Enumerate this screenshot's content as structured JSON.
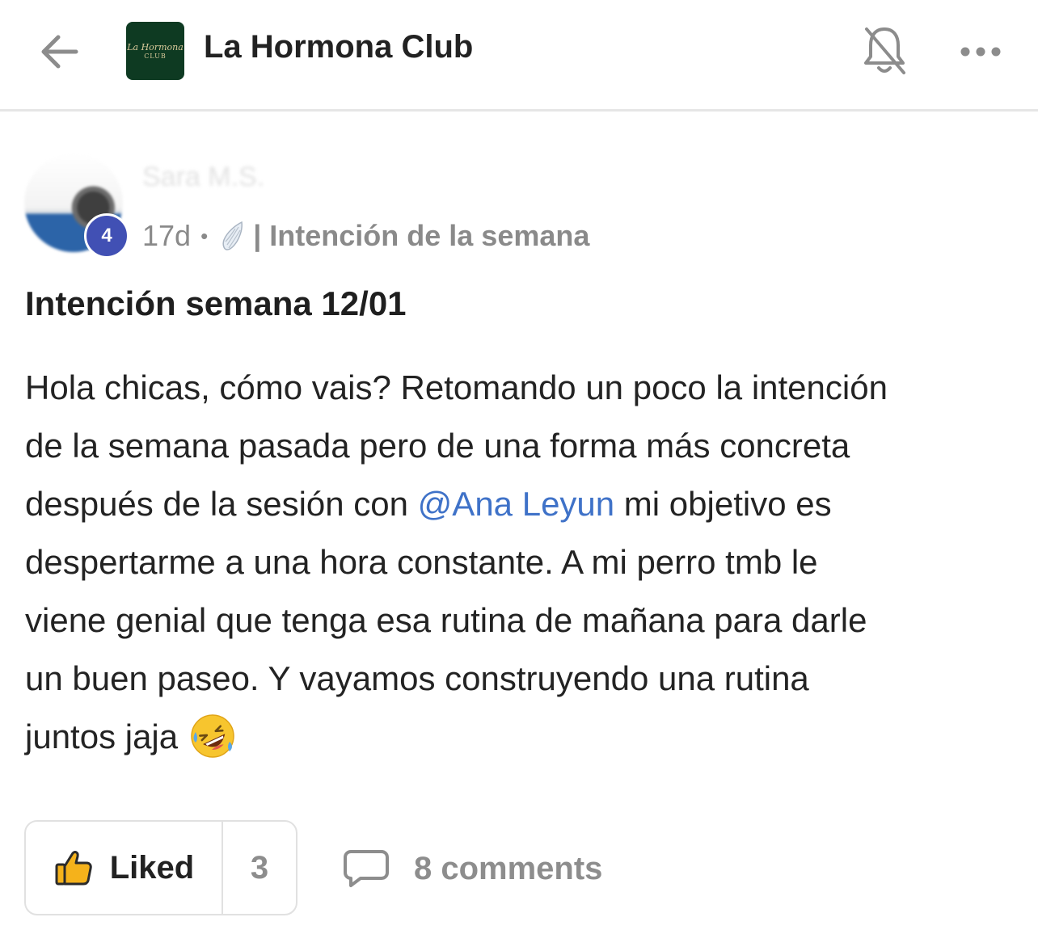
{
  "header": {
    "back_icon": "arrow-left-icon",
    "club_name": "La Hormona Club",
    "logo_line1": "La Hormona",
    "logo_line2": "CLUB",
    "notification_icon": "bell-off-icon",
    "more_icon": "more-horizontal-icon"
  },
  "author": {
    "name": "Sara M.S.",
    "level": "4",
    "time_ago": "17d",
    "separator": "•",
    "space_icon": "angel-wing-icon",
    "space_name": "| Intención de la semana"
  },
  "post": {
    "title": "Intención semana 12/01",
    "body_lines": [
      "Hola chicas, cómo vais? Retomando un poco la intención",
      "de la semana pasada pero de una forma más concreta",
      "después de la sesión con ",
      "despertarme a una hora constante. A mi perro tmb le",
      "viene genial que tenga esa rutina de mañana para darle",
      "un buen paseo. Y vayamos construyendo una rutina",
      "juntos jaja"
    ],
    "mention": "@Ana Leyun",
    "line3_after_mention": " mi objetivo es",
    "emoji": "rolling-on-the-floor-laughing-emoji"
  },
  "actions": {
    "like_label": "Liked",
    "like_count": "3",
    "like_icon": "thumbs-up-icon",
    "comments_label": "8 comments",
    "comments_icon": "comment-bubble-icon"
  },
  "colors": {
    "accent_mention": "#3f72c8",
    "level_badge": "#4150b4",
    "logo_bg": "#0e3a22",
    "thumb_fill": "#f5b21b"
  }
}
